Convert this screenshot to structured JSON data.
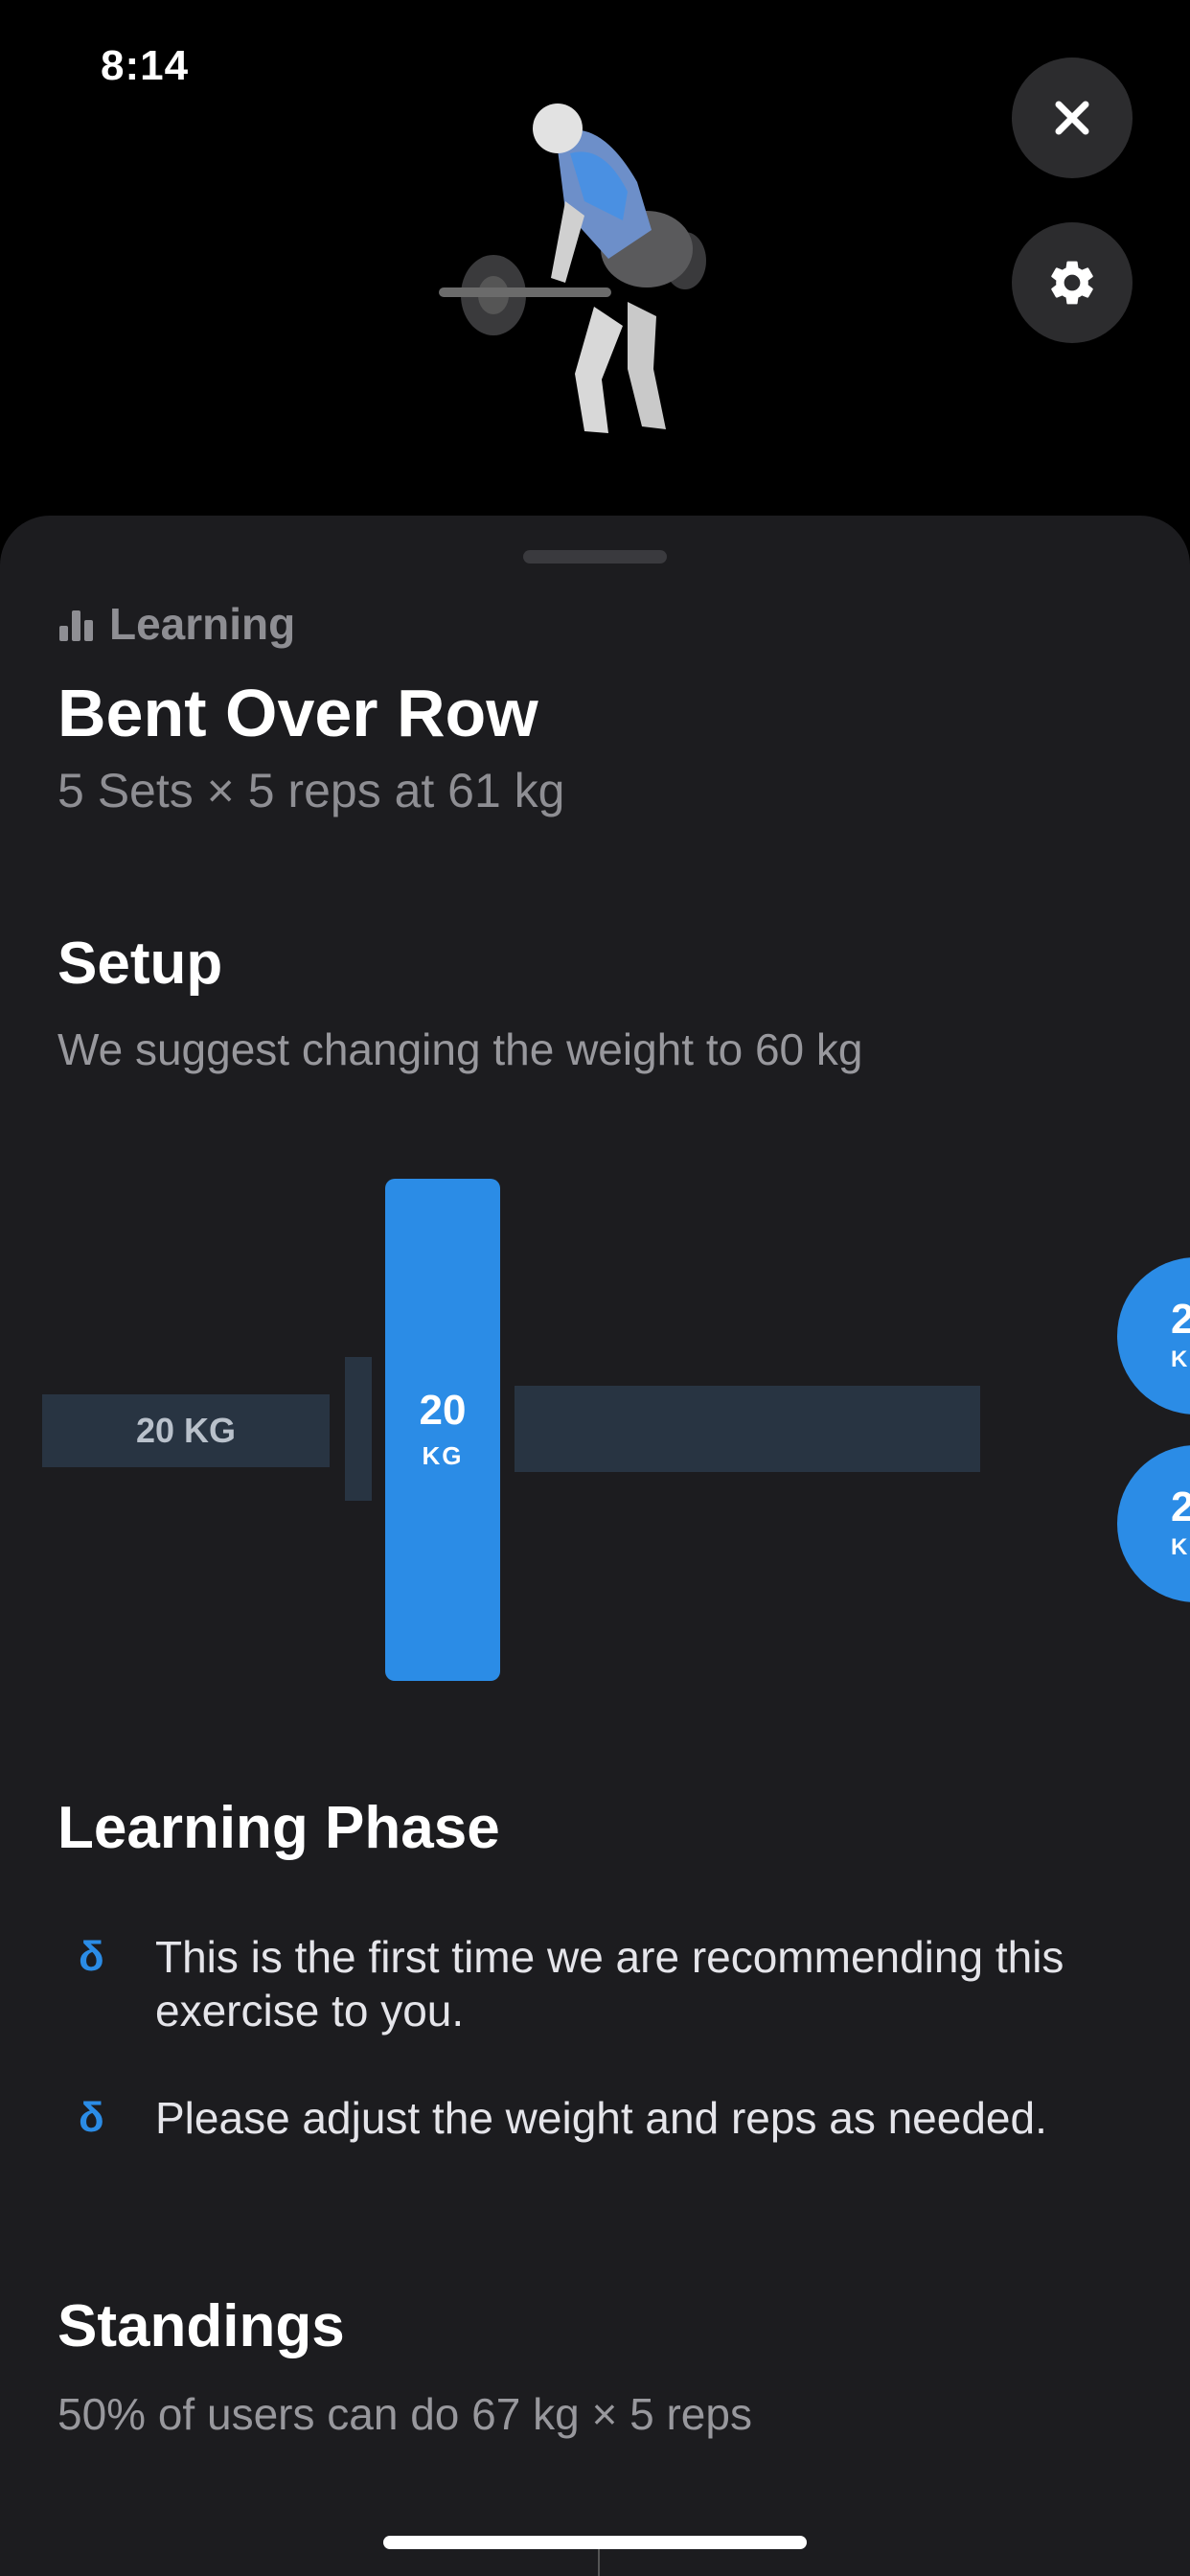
{
  "status_bar": {
    "time": "8:14"
  },
  "header": {
    "close_icon": "close-icon",
    "settings_icon": "gear-icon"
  },
  "exercise": {
    "level": "Learning",
    "name": "Bent Over Row",
    "prescription": "5 Sets × 5 reps at 61 kg"
  },
  "setup": {
    "heading": "Setup",
    "suggestion": "We suggest changing the weight to 60 kg",
    "bar_label": "20 KG",
    "main_plate": {
      "value": "20",
      "unit": "KG"
    },
    "extra_plates": [
      {
        "value": "2",
        "unit": "K"
      },
      {
        "value": "2",
        "unit": "K"
      }
    ]
  },
  "learning_phase": {
    "heading": "Learning Phase",
    "bullet_symbol": "δ",
    "items": [
      "This is the first time we are recommending this exercise to you.",
      "Please adjust the weight and reps as needed."
    ]
  },
  "standings": {
    "heading": "Standings",
    "text": "50% of users can do 67 kg × 5 reps"
  },
  "colors": {
    "accent": "#2b8ce6",
    "sheet_bg": "#1c1c1f",
    "bar": "#283442"
  }
}
